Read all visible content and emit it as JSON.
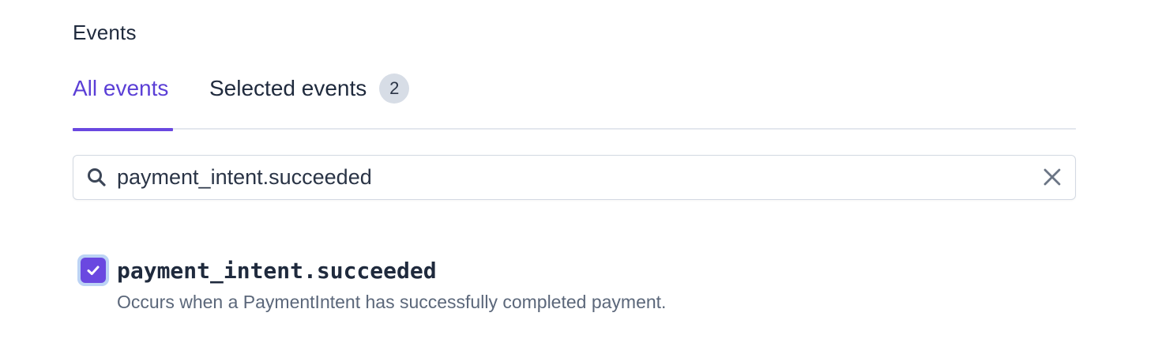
{
  "section": {
    "title": "Events"
  },
  "tabs": [
    {
      "label": "All events",
      "active": true
    },
    {
      "label": "Selected events",
      "badge": "2",
      "active": false
    }
  ],
  "search": {
    "value": "payment_intent.succeeded",
    "placeholder": "",
    "icon": "search-icon",
    "clear_icon": "close-icon"
  },
  "results": [
    {
      "name": "payment_intent.succeeded",
      "description": "Occurs when a PaymentIntent has successfully completed payment.",
      "checked": true
    }
  ],
  "colors": {
    "accent": "#6a48e0",
    "active_tab_text": "#5b3fd6",
    "checkbox_focus_ring": "#bcd3f5",
    "badge_bg": "#d7dde6"
  }
}
